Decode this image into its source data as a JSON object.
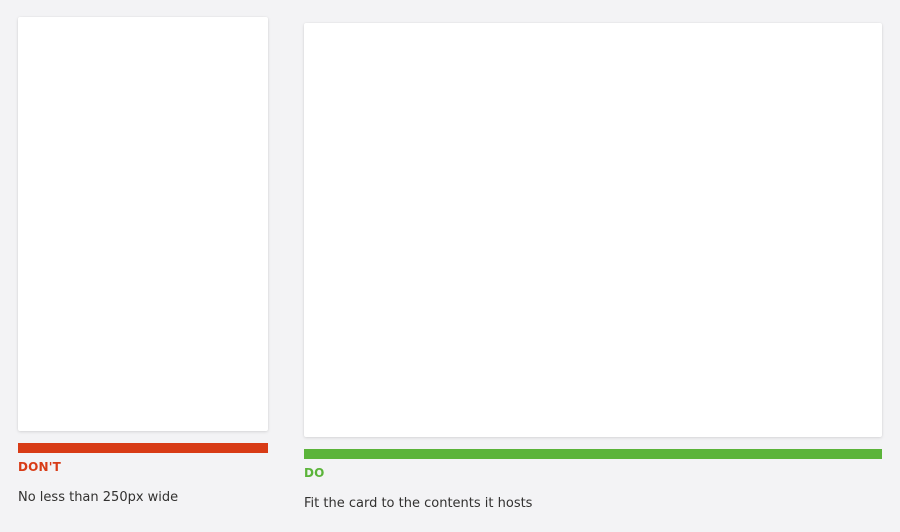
{
  "colors": {
    "dont": "#d83b16",
    "do": "#5bb43a",
    "background": "#f3f3f5",
    "card": "#ffffff",
    "text": "#323130"
  },
  "examples": {
    "dont": {
      "verdict": "DON'T",
      "caption": "No less than 250px wide"
    },
    "do": {
      "verdict": "DO",
      "caption": "Fit the card to the contents it hosts"
    }
  }
}
